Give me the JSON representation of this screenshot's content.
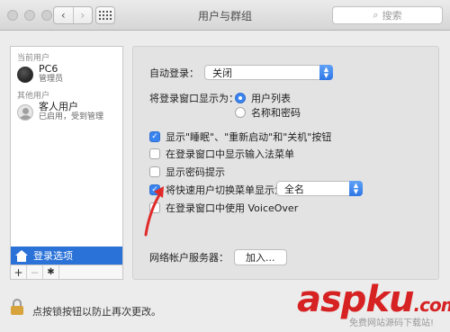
{
  "window": {
    "title": "用户与群组"
  },
  "search": {
    "placeholder": "搜索"
  },
  "sidebar": {
    "current_users_title": "当前用户",
    "current_user": {
      "name": "PC6",
      "role": "管理员"
    },
    "other_users_title": "其他用户",
    "guest_user": {
      "name": "客人用户",
      "status": "已启用，受到管理"
    },
    "login_options_label": "登录选项",
    "toolbar": {
      "add": "+",
      "remove": "−",
      "gear": "✱"
    }
  },
  "main": {
    "auto_login_label": "自动登录：",
    "auto_login_value": "关闭",
    "display_login_label": "将登录窗口显示为：",
    "radio_options": [
      "用户列表",
      "名称和密码"
    ],
    "checkboxes": [
      {
        "label": "显示\"睡眠\"、\"重新启动\"和\"关机\"按钮",
        "checked": true
      },
      {
        "label": "在登录窗口中显示输入法菜单",
        "checked": false
      },
      {
        "label": "显示密码提示",
        "checked": false
      },
      {
        "label": "将快速用户切换菜单显示为",
        "checked": true
      },
      {
        "label": "在登录窗口中使用 VoiceOver",
        "checked": false
      }
    ],
    "fast_switch_value": "全名",
    "network_server_label": "网络帐户服务器：",
    "join_button": "加入..."
  },
  "footer": {
    "lock_text": "点按锁按钮以防止再次更改。"
  },
  "watermark": {
    "text": "aspku",
    "suffix": ".com",
    "sub": "免费网站源码下载站!"
  }
}
